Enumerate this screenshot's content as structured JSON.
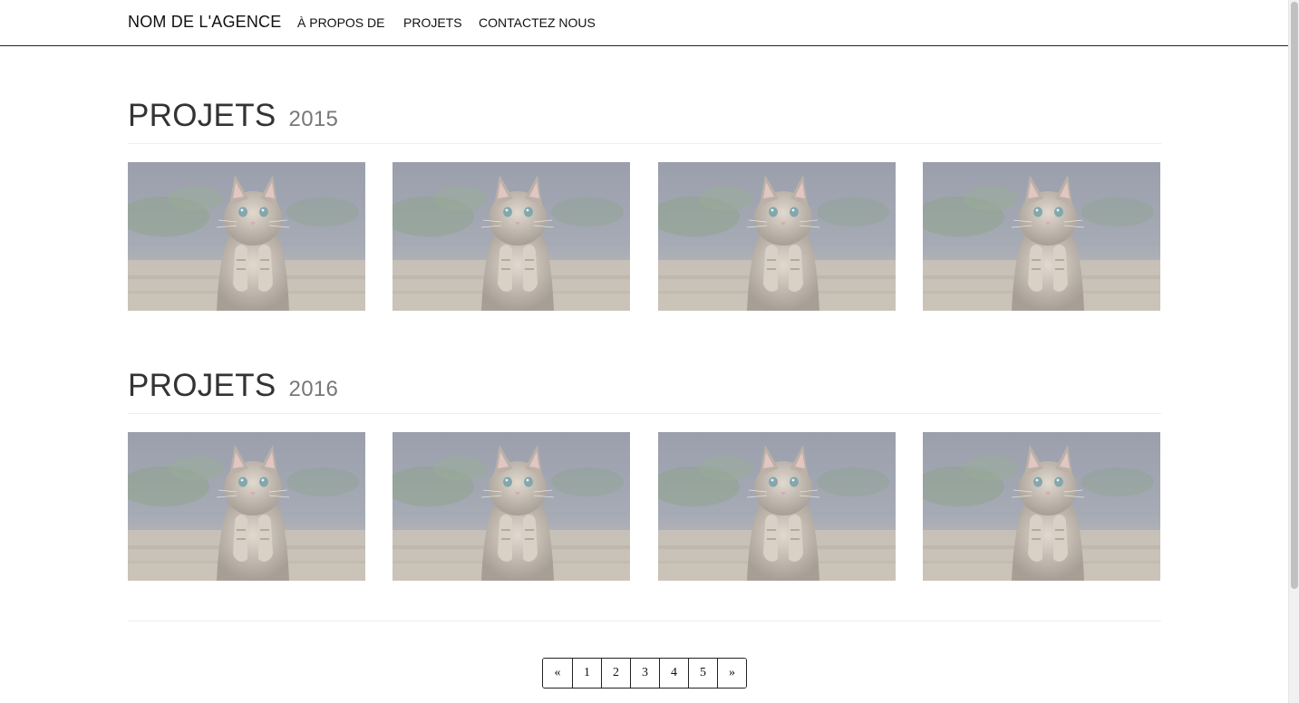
{
  "navbar": {
    "brand": "NOM DE L'AGENCE",
    "links": [
      "À PROPOS DE",
      "PROJETS",
      "CONTACTEZ NOUS"
    ]
  },
  "sections": [
    {
      "title": "PROJETS",
      "year": "2015"
    },
    {
      "title": "PROJETS",
      "year": "2016"
    }
  ],
  "thumbnails": {
    "icon": "kitten-image",
    "count_per_section": 4
  },
  "pagination": {
    "prev": "«",
    "pages": [
      "1",
      "2",
      "3",
      "4",
      "5"
    ],
    "next": "»"
  },
  "colors": {
    "heading": "#333333",
    "subheading": "#777777",
    "divider": "#eeeeee",
    "nav_border": "#222222"
  }
}
